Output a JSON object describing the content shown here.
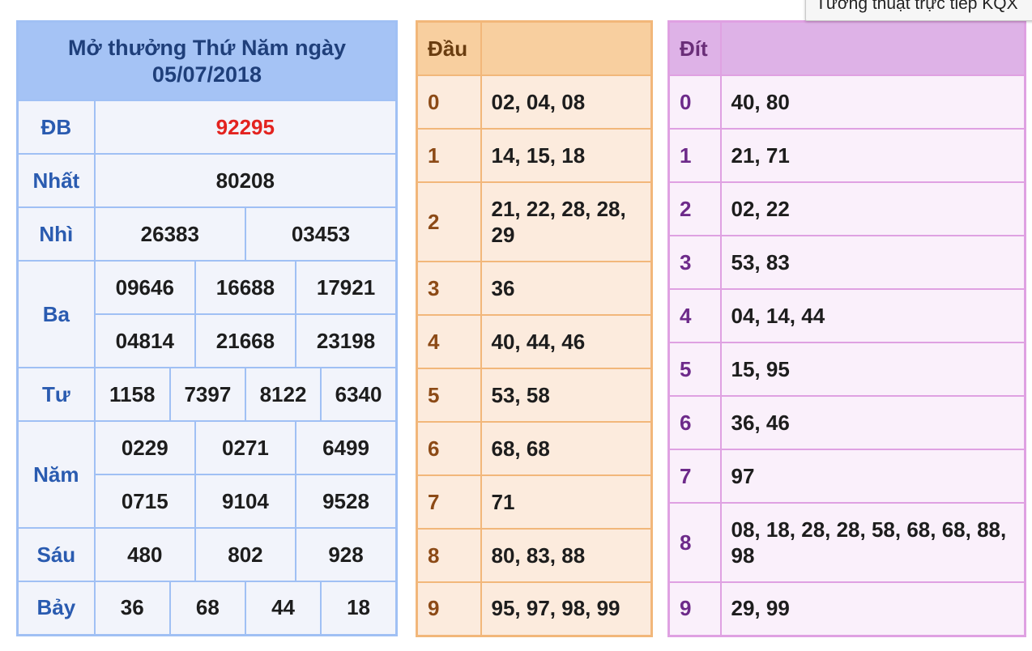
{
  "tooltip": "Tường thuật trực tiếp KQX",
  "result": {
    "title": "Mở thưởng Thứ Năm ngày 05/07/2018",
    "rows": {
      "db": {
        "label": "ĐB",
        "values": [
          "92295"
        ]
      },
      "nhat": {
        "label": "Nhất",
        "values": [
          "80208"
        ]
      },
      "nhi": {
        "label": "Nhì",
        "values": [
          "26383",
          "03453"
        ]
      },
      "ba": {
        "label": "Ba",
        "values": [
          "09646",
          "16688",
          "17921",
          "04814",
          "21668",
          "23198"
        ]
      },
      "tu": {
        "label": "Tư",
        "values": [
          "1158",
          "7397",
          "8122",
          "6340"
        ]
      },
      "nam": {
        "label": "Năm",
        "values": [
          "0229",
          "0271",
          "6499",
          "0715",
          "9104",
          "9528"
        ]
      },
      "sau": {
        "label": "Sáu",
        "values": [
          "480",
          "802",
          "928"
        ]
      },
      "bay": {
        "label": "Bảy",
        "values": [
          "36",
          "68",
          "44",
          "18"
        ]
      }
    }
  },
  "dau": {
    "header": "Đầu",
    "rows": [
      {
        "key": "0",
        "values": "02, 04, 08"
      },
      {
        "key": "1",
        "values": "14, 15, 18"
      },
      {
        "key": "2",
        "values": "21, 22, 28, 28, 29"
      },
      {
        "key": "3",
        "values": "36"
      },
      {
        "key": "4",
        "values": "40, 44, 46"
      },
      {
        "key": "5",
        "values": "53, 58"
      },
      {
        "key": "6",
        "values": "68, 68"
      },
      {
        "key": "7",
        "values": "71"
      },
      {
        "key": "8",
        "values": "80, 83, 88"
      },
      {
        "key": "9",
        "values": "95, 97, 98, 99"
      }
    ]
  },
  "dit": {
    "header": "Đít",
    "rows": [
      {
        "key": "0",
        "values": "40, 80"
      },
      {
        "key": "1",
        "values": "21, 71"
      },
      {
        "key": "2",
        "values": "02, 22"
      },
      {
        "key": "3",
        "values": "53, 83"
      },
      {
        "key": "4",
        "values": "04, 14, 44"
      },
      {
        "key": "5",
        "values": "15, 95"
      },
      {
        "key": "6",
        "values": "36, 46"
      },
      {
        "key": "7",
        "values": "97"
      },
      {
        "key": "8",
        "values": "08, 18, 28, 28, 58, 68, 68, 88, 98"
      },
      {
        "key": "9",
        "values": "29, 99"
      }
    ]
  },
  "colors": {
    "prize_special": "#e3231f",
    "result_border": "#a0c0f4",
    "dau_border": "#f2b77a",
    "dit_border": "#dfa1e2"
  }
}
